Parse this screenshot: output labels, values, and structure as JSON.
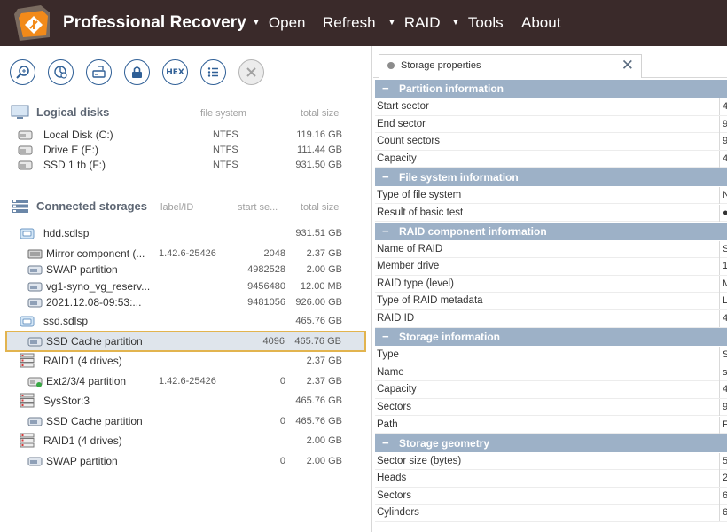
{
  "app": {
    "title": "Professional Recovery",
    "menu": [
      {
        "label": "Open",
        "has_arrow": true
      },
      {
        "label": "Refresh",
        "has_arrow": false
      },
      {
        "label": "RAID",
        "has_arrow": true
      },
      {
        "label": "Tools",
        "has_arrow": true
      },
      {
        "label": "About",
        "has_arrow": false
      }
    ],
    "arrow_glyph": "▼"
  },
  "toolbar": {
    "buttons": [
      "search-icon",
      "scan-icon",
      "image-icon",
      "lock-icon",
      "hex-icon",
      "list-icon",
      "close-icon"
    ],
    "hex_label": "HEX"
  },
  "logical_disks": {
    "title": "Logical disks",
    "columns": {
      "fs": "file system",
      "size": "total size"
    },
    "items": [
      {
        "name": "Local Disk (C:)",
        "fs": "NTFS",
        "size": "119.16 GB"
      },
      {
        "name": "Drive E (E:)",
        "fs": "NTFS",
        "size": "111.44 GB"
      },
      {
        "name": "SSD 1 tb (F:)",
        "fs": "NTFS",
        "size": "931.50 GB"
      }
    ]
  },
  "connected_storages": {
    "title": "Connected storages",
    "columns": {
      "label": "label/ID",
      "start": "start se...",
      "size": "total size"
    },
    "items": [
      {
        "name": "hdd.sdlsp",
        "label": "",
        "start": "",
        "size": "931.51 GB",
        "level": 0,
        "icon": "image-file-icon"
      },
      {
        "name": "Mirror component (...",
        "label": "1.42.6-25426",
        "start": "2048",
        "size": "2.37 GB",
        "level": 1,
        "icon": "raid-component-icon"
      },
      {
        "name": "SWAP partition",
        "label": "",
        "start": "4982528",
        "size": "2.00 GB",
        "level": 1,
        "icon": "partition-icon"
      },
      {
        "name": "vg1-syno_vg_reserv...",
        "label": "",
        "start": "9456480",
        "size": "12.00 MB",
        "level": 1,
        "icon": "partition-icon"
      },
      {
        "name": "2021.12.08-09:53:...",
        "label": "",
        "start": "9481056",
        "size": "926.00 GB",
        "level": 1,
        "icon": "partition-icon"
      },
      {
        "name": "ssd.sdlsp",
        "label": "",
        "start": "",
        "size": "465.76 GB",
        "level": 0,
        "icon": "image-file-icon"
      },
      {
        "name": "SSD Cache partition",
        "label": "",
        "start": "4096",
        "size": "465.76 GB",
        "level": 1,
        "icon": "partition-icon",
        "selected": true
      },
      {
        "name": "RAID1 (4 drives)",
        "label": "",
        "start": "",
        "size": "2.37 GB",
        "level": 0,
        "icon": "raid-icon"
      },
      {
        "name": "Ext2/3/4 partition",
        "label": "1.42.6-25426",
        "start": "0",
        "size": "2.37 GB",
        "level": 1,
        "icon": "partition-green-icon"
      },
      {
        "name": "SysStor:3",
        "label": "",
        "start": "",
        "size": "465.76 GB",
        "level": 0,
        "icon": "raid-icon"
      },
      {
        "name": "SSD Cache partition",
        "label": "",
        "start": "0",
        "size": "465.76 GB",
        "level": 1,
        "icon": "partition-icon"
      },
      {
        "name": "RAID1 (4 drives)",
        "label": "",
        "start": "",
        "size": "2.00 GB",
        "level": 0,
        "icon": "raid-icon"
      },
      {
        "name": "SWAP partition",
        "label": "",
        "start": "0",
        "size": "2.00 GB",
        "level": 1,
        "icon": "partition-icon"
      }
    ]
  },
  "properties": {
    "tab_label": "Storage properties",
    "groups": [
      {
        "title": "Partition information",
        "rows": [
          {
            "key": "Start sector",
            "value": "4"
          },
          {
            "key": "End sector",
            "value": "9"
          },
          {
            "key": "Count sectors",
            "value": "9"
          },
          {
            "key": "Capacity",
            "value": "4"
          }
        ]
      },
      {
        "title": "File system information",
        "rows": [
          {
            "key": "Type of file system",
            "value": "N"
          },
          {
            "key": "Result of basic test",
            "value": "●"
          }
        ]
      },
      {
        "title": "RAID component information",
        "rows": [
          {
            "key": "Name of RAID",
            "value": "S"
          },
          {
            "key": "Member drive",
            "value": "1"
          },
          {
            "key": "RAID type (level)",
            "value": "M"
          },
          {
            "key": "Type of RAID metadata",
            "value": "L"
          },
          {
            "key": "RAID ID",
            "value": "4"
          }
        ]
      },
      {
        "title": "Storage information",
        "rows": [
          {
            "key": "Type",
            "value": "S"
          },
          {
            "key": "Name",
            "value": "s"
          },
          {
            "key": "Capacity",
            "value": "4"
          },
          {
            "key": "Sectors",
            "value": "9"
          },
          {
            "key": "Path",
            "value": "F"
          }
        ]
      },
      {
        "title": "Storage geometry",
        "rows": [
          {
            "key": "Sector size (bytes)",
            "value": "5"
          },
          {
            "key": "Heads",
            "value": "2"
          },
          {
            "key": "Sectors",
            "value": "6"
          },
          {
            "key": "Cylinders",
            "value": "6"
          }
        ]
      }
    ]
  },
  "colors": {
    "topbar": "#3a2a2a",
    "accent": "#2f5f96",
    "group_header": "#9db1c7",
    "selection_outline": "#e2b44f"
  }
}
